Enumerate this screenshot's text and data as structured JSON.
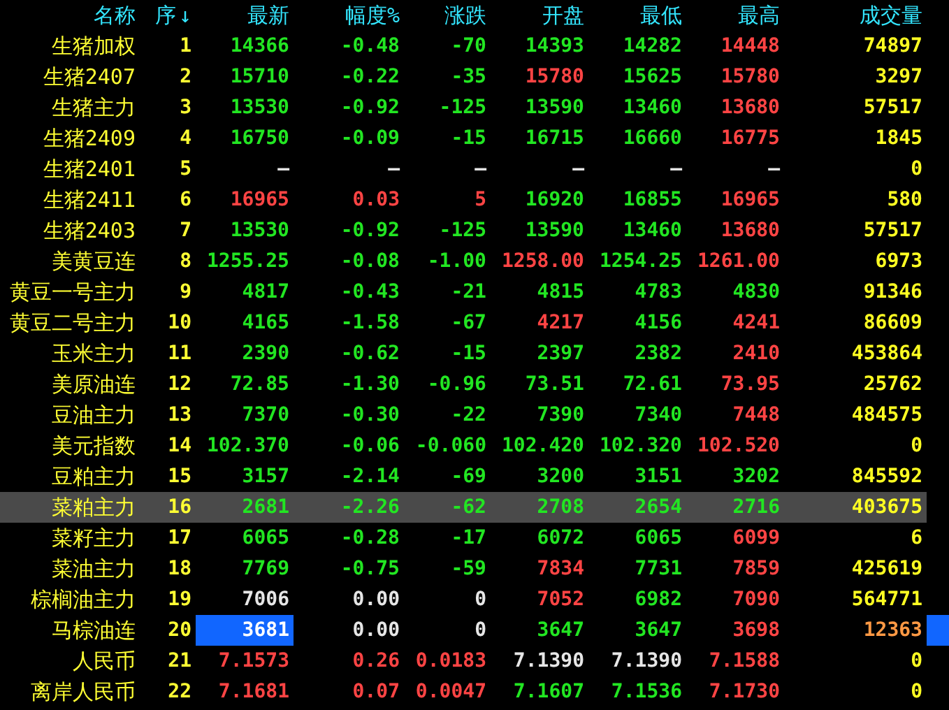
{
  "columns": [
    {
      "label": "名称"
    },
    {
      "label": "序",
      "sort_mark": "↓"
    },
    {
      "label": "最新"
    },
    {
      "label": "幅度%"
    },
    {
      "label": "涨跌"
    },
    {
      "label": "开盘"
    },
    {
      "label": "最低"
    },
    {
      "label": "最高"
    },
    {
      "label": "成交量"
    }
  ],
  "rows": [
    {
      "name": "生猪加权",
      "seq": "1",
      "selected": false,
      "flash": false,
      "cells": [
        {
          "text": "14366",
          "color": "#22e622"
        },
        {
          "text": "-0.48",
          "color": "#22e622"
        },
        {
          "text": "-70",
          "color": "#22e622"
        },
        {
          "text": "14393",
          "color": "#22e622"
        },
        {
          "text": "14282",
          "color": "#22e622"
        },
        {
          "text": "14448",
          "color": "#ff4444"
        },
        {
          "text": "74897",
          "color": "#ffff22"
        }
      ]
    },
    {
      "name": "生猪2407",
      "seq": "2",
      "selected": false,
      "flash": false,
      "cells": [
        {
          "text": "15710",
          "color": "#22e622"
        },
        {
          "text": "-0.22",
          "color": "#22e622"
        },
        {
          "text": "-35",
          "color": "#22e622"
        },
        {
          "text": "15780",
          "color": "#ff4444"
        },
        {
          "text": "15625",
          "color": "#22e622"
        },
        {
          "text": "15780",
          "color": "#ff4444"
        },
        {
          "text": "3297",
          "color": "#ffff22"
        }
      ]
    },
    {
      "name": "生猪主力",
      "seq": "3",
      "selected": false,
      "flash": false,
      "cells": [
        {
          "text": "13530",
          "color": "#22e622"
        },
        {
          "text": "-0.92",
          "color": "#22e622"
        },
        {
          "text": "-125",
          "color": "#22e622"
        },
        {
          "text": "13590",
          "color": "#22e622"
        },
        {
          "text": "13460",
          "color": "#22e622"
        },
        {
          "text": "13680",
          "color": "#ff4444"
        },
        {
          "text": "57517",
          "color": "#ffff22"
        }
      ]
    },
    {
      "name": "生猪2409",
      "seq": "4",
      "selected": false,
      "flash": false,
      "cells": [
        {
          "text": "16750",
          "color": "#22e622"
        },
        {
          "text": "-0.09",
          "color": "#22e622"
        },
        {
          "text": "-15",
          "color": "#22e622"
        },
        {
          "text": "16715",
          "color": "#22e622"
        },
        {
          "text": "16660",
          "color": "#22e622"
        },
        {
          "text": "16775",
          "color": "#ff4444"
        },
        {
          "text": "1845",
          "color": "#ffff22"
        }
      ]
    },
    {
      "name": "生猪2401",
      "seq": "5",
      "selected": false,
      "flash": false,
      "cells": [
        {
          "text": "—",
          "color": "#e6e6e6"
        },
        {
          "text": "—",
          "color": "#e6e6e6"
        },
        {
          "text": "—",
          "color": "#e6e6e6"
        },
        {
          "text": "—",
          "color": "#e6e6e6"
        },
        {
          "text": "—",
          "color": "#e6e6e6"
        },
        {
          "text": "—",
          "color": "#e6e6e6"
        },
        {
          "text": "0",
          "color": "#ffff22"
        }
      ]
    },
    {
      "name": "生猪2411",
      "seq": "6",
      "selected": false,
      "flash": false,
      "cells": [
        {
          "text": "16965",
          "color": "#ff4444"
        },
        {
          "text": "0.03",
          "color": "#ff4444"
        },
        {
          "text": "5",
          "color": "#ff4444"
        },
        {
          "text": "16920",
          "color": "#22e622"
        },
        {
          "text": "16855",
          "color": "#22e622"
        },
        {
          "text": "16965",
          "color": "#ff4444"
        },
        {
          "text": "580",
          "color": "#ffff22"
        }
      ]
    },
    {
      "name": "生猪2403",
      "seq": "7",
      "selected": false,
      "flash": false,
      "cells": [
        {
          "text": "13530",
          "color": "#22e622"
        },
        {
          "text": "-0.92",
          "color": "#22e622"
        },
        {
          "text": "-125",
          "color": "#22e622"
        },
        {
          "text": "13590",
          "color": "#22e622"
        },
        {
          "text": "13460",
          "color": "#22e622"
        },
        {
          "text": "13680",
          "color": "#ff4444"
        },
        {
          "text": "57517",
          "color": "#ffff22"
        }
      ]
    },
    {
      "name": "美黄豆连",
      "seq": "8",
      "selected": false,
      "flash": false,
      "cells": [
        {
          "text": "1255.25",
          "color": "#22e622"
        },
        {
          "text": "-0.08",
          "color": "#22e622"
        },
        {
          "text": "-1.00",
          "color": "#22e622"
        },
        {
          "text": "1258.00",
          "color": "#ff4444"
        },
        {
          "text": "1254.25",
          "color": "#22e622"
        },
        {
          "text": "1261.00",
          "color": "#ff4444"
        },
        {
          "text": "6973",
          "color": "#ffff22"
        }
      ]
    },
    {
      "name": "黄豆一号主力",
      "seq": "9",
      "selected": false,
      "flash": false,
      "cells": [
        {
          "text": "4817",
          "color": "#22e622"
        },
        {
          "text": "-0.43",
          "color": "#22e622"
        },
        {
          "text": "-21",
          "color": "#22e622"
        },
        {
          "text": "4815",
          "color": "#22e622"
        },
        {
          "text": "4783",
          "color": "#22e622"
        },
        {
          "text": "4830",
          "color": "#22e622"
        },
        {
          "text": "91346",
          "color": "#ffff22"
        }
      ]
    },
    {
      "name": "黄豆二号主力",
      "seq": "10",
      "selected": false,
      "flash": false,
      "cells": [
        {
          "text": "4165",
          "color": "#22e622"
        },
        {
          "text": "-1.58",
          "color": "#22e622"
        },
        {
          "text": "-67",
          "color": "#22e622"
        },
        {
          "text": "4217",
          "color": "#ff4444"
        },
        {
          "text": "4156",
          "color": "#22e622"
        },
        {
          "text": "4241",
          "color": "#ff4444"
        },
        {
          "text": "86609",
          "color": "#ffff22"
        }
      ]
    },
    {
      "name": "玉米主力",
      "seq": "11",
      "selected": false,
      "flash": false,
      "cells": [
        {
          "text": "2390",
          "color": "#22e622"
        },
        {
          "text": "-0.62",
          "color": "#22e622"
        },
        {
          "text": "-15",
          "color": "#22e622"
        },
        {
          "text": "2397",
          "color": "#22e622"
        },
        {
          "text": "2382",
          "color": "#22e622"
        },
        {
          "text": "2410",
          "color": "#ff4444"
        },
        {
          "text": "453864",
          "color": "#ffff22"
        }
      ]
    },
    {
      "name": "美原油连",
      "seq": "12",
      "selected": false,
      "flash": false,
      "cells": [
        {
          "text": "72.85",
          "color": "#22e622"
        },
        {
          "text": "-1.30",
          "color": "#22e622"
        },
        {
          "text": "-0.96",
          "color": "#22e622"
        },
        {
          "text": "73.51",
          "color": "#22e622"
        },
        {
          "text": "72.61",
          "color": "#22e622"
        },
        {
          "text": "73.95",
          "color": "#ff4444"
        },
        {
          "text": "25762",
          "color": "#ffff22"
        }
      ]
    },
    {
      "name": "豆油主力",
      "seq": "13",
      "selected": false,
      "flash": false,
      "cells": [
        {
          "text": "7370",
          "color": "#22e622"
        },
        {
          "text": "-0.30",
          "color": "#22e622"
        },
        {
          "text": "-22",
          "color": "#22e622"
        },
        {
          "text": "7390",
          "color": "#22e622"
        },
        {
          "text": "7340",
          "color": "#22e622"
        },
        {
          "text": "7448",
          "color": "#ff4444"
        },
        {
          "text": "484575",
          "color": "#ffff22"
        }
      ]
    },
    {
      "name": "美元指数",
      "seq": "14",
      "selected": false,
      "flash": false,
      "cells": [
        {
          "text": "102.370",
          "color": "#22e622"
        },
        {
          "text": "-0.06",
          "color": "#22e622"
        },
        {
          "text": "-0.060",
          "color": "#22e622"
        },
        {
          "text": "102.420",
          "color": "#22e622"
        },
        {
          "text": "102.320",
          "color": "#22e622"
        },
        {
          "text": "102.520",
          "color": "#ff4444"
        },
        {
          "text": "0",
          "color": "#ffff22"
        }
      ]
    },
    {
      "name": "豆粕主力",
      "seq": "15",
      "selected": false,
      "flash": false,
      "cells": [
        {
          "text": "3157",
          "color": "#22e622"
        },
        {
          "text": "-2.14",
          "color": "#22e622"
        },
        {
          "text": "-69",
          "color": "#22e622"
        },
        {
          "text": "3200",
          "color": "#22e622"
        },
        {
          "text": "3151",
          "color": "#22e622"
        },
        {
          "text": "3202",
          "color": "#22e622"
        },
        {
          "text": "845592",
          "color": "#ffff22"
        }
      ]
    },
    {
      "name": "菜粕主力",
      "seq": "16",
      "selected": true,
      "flash": false,
      "cells": [
        {
          "text": "2681",
          "color": "#22e622"
        },
        {
          "text": "-2.26",
          "color": "#22e622"
        },
        {
          "text": "-62",
          "color": "#22e622"
        },
        {
          "text": "2708",
          "color": "#22e622"
        },
        {
          "text": "2654",
          "color": "#22e622"
        },
        {
          "text": "2716",
          "color": "#22e622"
        },
        {
          "text": "403675",
          "color": "#ffff22"
        }
      ]
    },
    {
      "name": "菜籽主力",
      "seq": "17",
      "selected": false,
      "flash": false,
      "cells": [
        {
          "text": "6065",
          "color": "#22e622"
        },
        {
          "text": "-0.28",
          "color": "#22e622"
        },
        {
          "text": "-17",
          "color": "#22e622"
        },
        {
          "text": "6072",
          "color": "#22e622"
        },
        {
          "text": "6065",
          "color": "#22e622"
        },
        {
          "text": "6099",
          "color": "#ff4444"
        },
        {
          "text": "6",
          "color": "#ffff22"
        }
      ]
    },
    {
      "name": "菜油主力",
      "seq": "18",
      "selected": false,
      "flash": false,
      "cells": [
        {
          "text": "7769",
          "color": "#22e622"
        },
        {
          "text": "-0.75",
          "color": "#22e622"
        },
        {
          "text": "-59",
          "color": "#22e622"
        },
        {
          "text": "7834",
          "color": "#ff4444"
        },
        {
          "text": "7731",
          "color": "#22e622"
        },
        {
          "text": "7859",
          "color": "#ff4444"
        },
        {
          "text": "425619",
          "color": "#ffff22"
        }
      ]
    },
    {
      "name": "棕榈油主力",
      "seq": "19",
      "selected": false,
      "flash": false,
      "cells": [
        {
          "text": "7006",
          "color": "#e6e6e6"
        },
        {
          "text": "0.00",
          "color": "#e6e6e6"
        },
        {
          "text": "0",
          "color": "#e6e6e6"
        },
        {
          "text": "7052",
          "color": "#ff4444"
        },
        {
          "text": "6982",
          "color": "#22e622"
        },
        {
          "text": "7090",
          "color": "#ff4444"
        },
        {
          "text": "564771",
          "color": "#ffff22"
        }
      ]
    },
    {
      "name": "马棕油连",
      "seq": "20",
      "selected": false,
      "flash": true,
      "cells": [
        {
          "text": "3681",
          "color": "#ffffff"
        },
        {
          "text": "0.00",
          "color": "#e6e6e6"
        },
        {
          "text": "0",
          "color": "#e6e6e6"
        },
        {
          "text": "3647",
          "color": "#22e622"
        },
        {
          "text": "3647",
          "color": "#22e622"
        },
        {
          "text": "3698",
          "color": "#ff4444"
        },
        {
          "text": "12363",
          "color": "#ff9944"
        }
      ]
    },
    {
      "name": "人民币",
      "seq": "21",
      "selected": false,
      "flash": false,
      "cells": [
        {
          "text": "7.1573",
          "color": "#ff4444"
        },
        {
          "text": "0.26",
          "color": "#ff4444"
        },
        {
          "text": "0.0183",
          "color": "#ff4444"
        },
        {
          "text": "7.1390",
          "color": "#e6e6e6"
        },
        {
          "text": "7.1390",
          "color": "#e6e6e6"
        },
        {
          "text": "7.1588",
          "color": "#ff4444"
        },
        {
          "text": "0",
          "color": "#ffff22"
        }
      ]
    },
    {
      "name": "离岸人民币",
      "seq": "22",
      "selected": false,
      "flash": false,
      "cells": [
        {
          "text": "7.1681",
          "color": "#ff4444"
        },
        {
          "text": "0.07",
          "color": "#ff4444"
        },
        {
          "text": "0.0047",
          "color": "#ff4444"
        },
        {
          "text": "7.1607",
          "color": "#22e622"
        },
        {
          "text": "7.1536",
          "color": "#22e622"
        },
        {
          "text": "7.1730",
          "color": "#ff4444"
        },
        {
          "text": "0",
          "color": "#ffff22"
        }
      ]
    }
  ]
}
